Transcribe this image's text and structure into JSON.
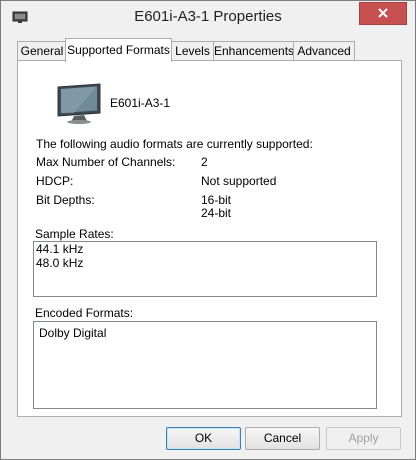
{
  "window": {
    "title": "E601i-A3-1 Properties",
    "app_icon": "speaker-icon",
    "close_icon": "close-icon"
  },
  "tabs": [
    {
      "label": "General",
      "active": false
    },
    {
      "label": "Supported Formats",
      "active": true
    },
    {
      "label": "Levels",
      "active": false
    },
    {
      "label": "Enhancements",
      "active": false
    },
    {
      "label": "Advanced",
      "active": false
    }
  ],
  "device": {
    "name": "E601i-A3-1",
    "icon": "monitor-icon"
  },
  "formats": {
    "intro": "The following audio formats are currently supported:",
    "channels_label": "Max Number of Channels:",
    "channels_value": "2",
    "hdcp_label": "HDCP:",
    "hdcp_value": "Not supported",
    "bit_depths_label": "Bit Depths:",
    "bit_depths": [
      "16-bit",
      "24-bit"
    ]
  },
  "sample_rates": {
    "label": "Sample Rates:",
    "items": [
      "44.1 kHz",
      "48.0 kHz"
    ]
  },
  "encoded_formats": {
    "label": "Encoded Formats:",
    "items": [
      "Dolby Digital"
    ]
  },
  "buttons": {
    "ok": "OK",
    "cancel": "Cancel",
    "apply": "Apply"
  },
  "colors": {
    "close_button": "#c75050",
    "default_button_border": "#3c7fb1"
  }
}
